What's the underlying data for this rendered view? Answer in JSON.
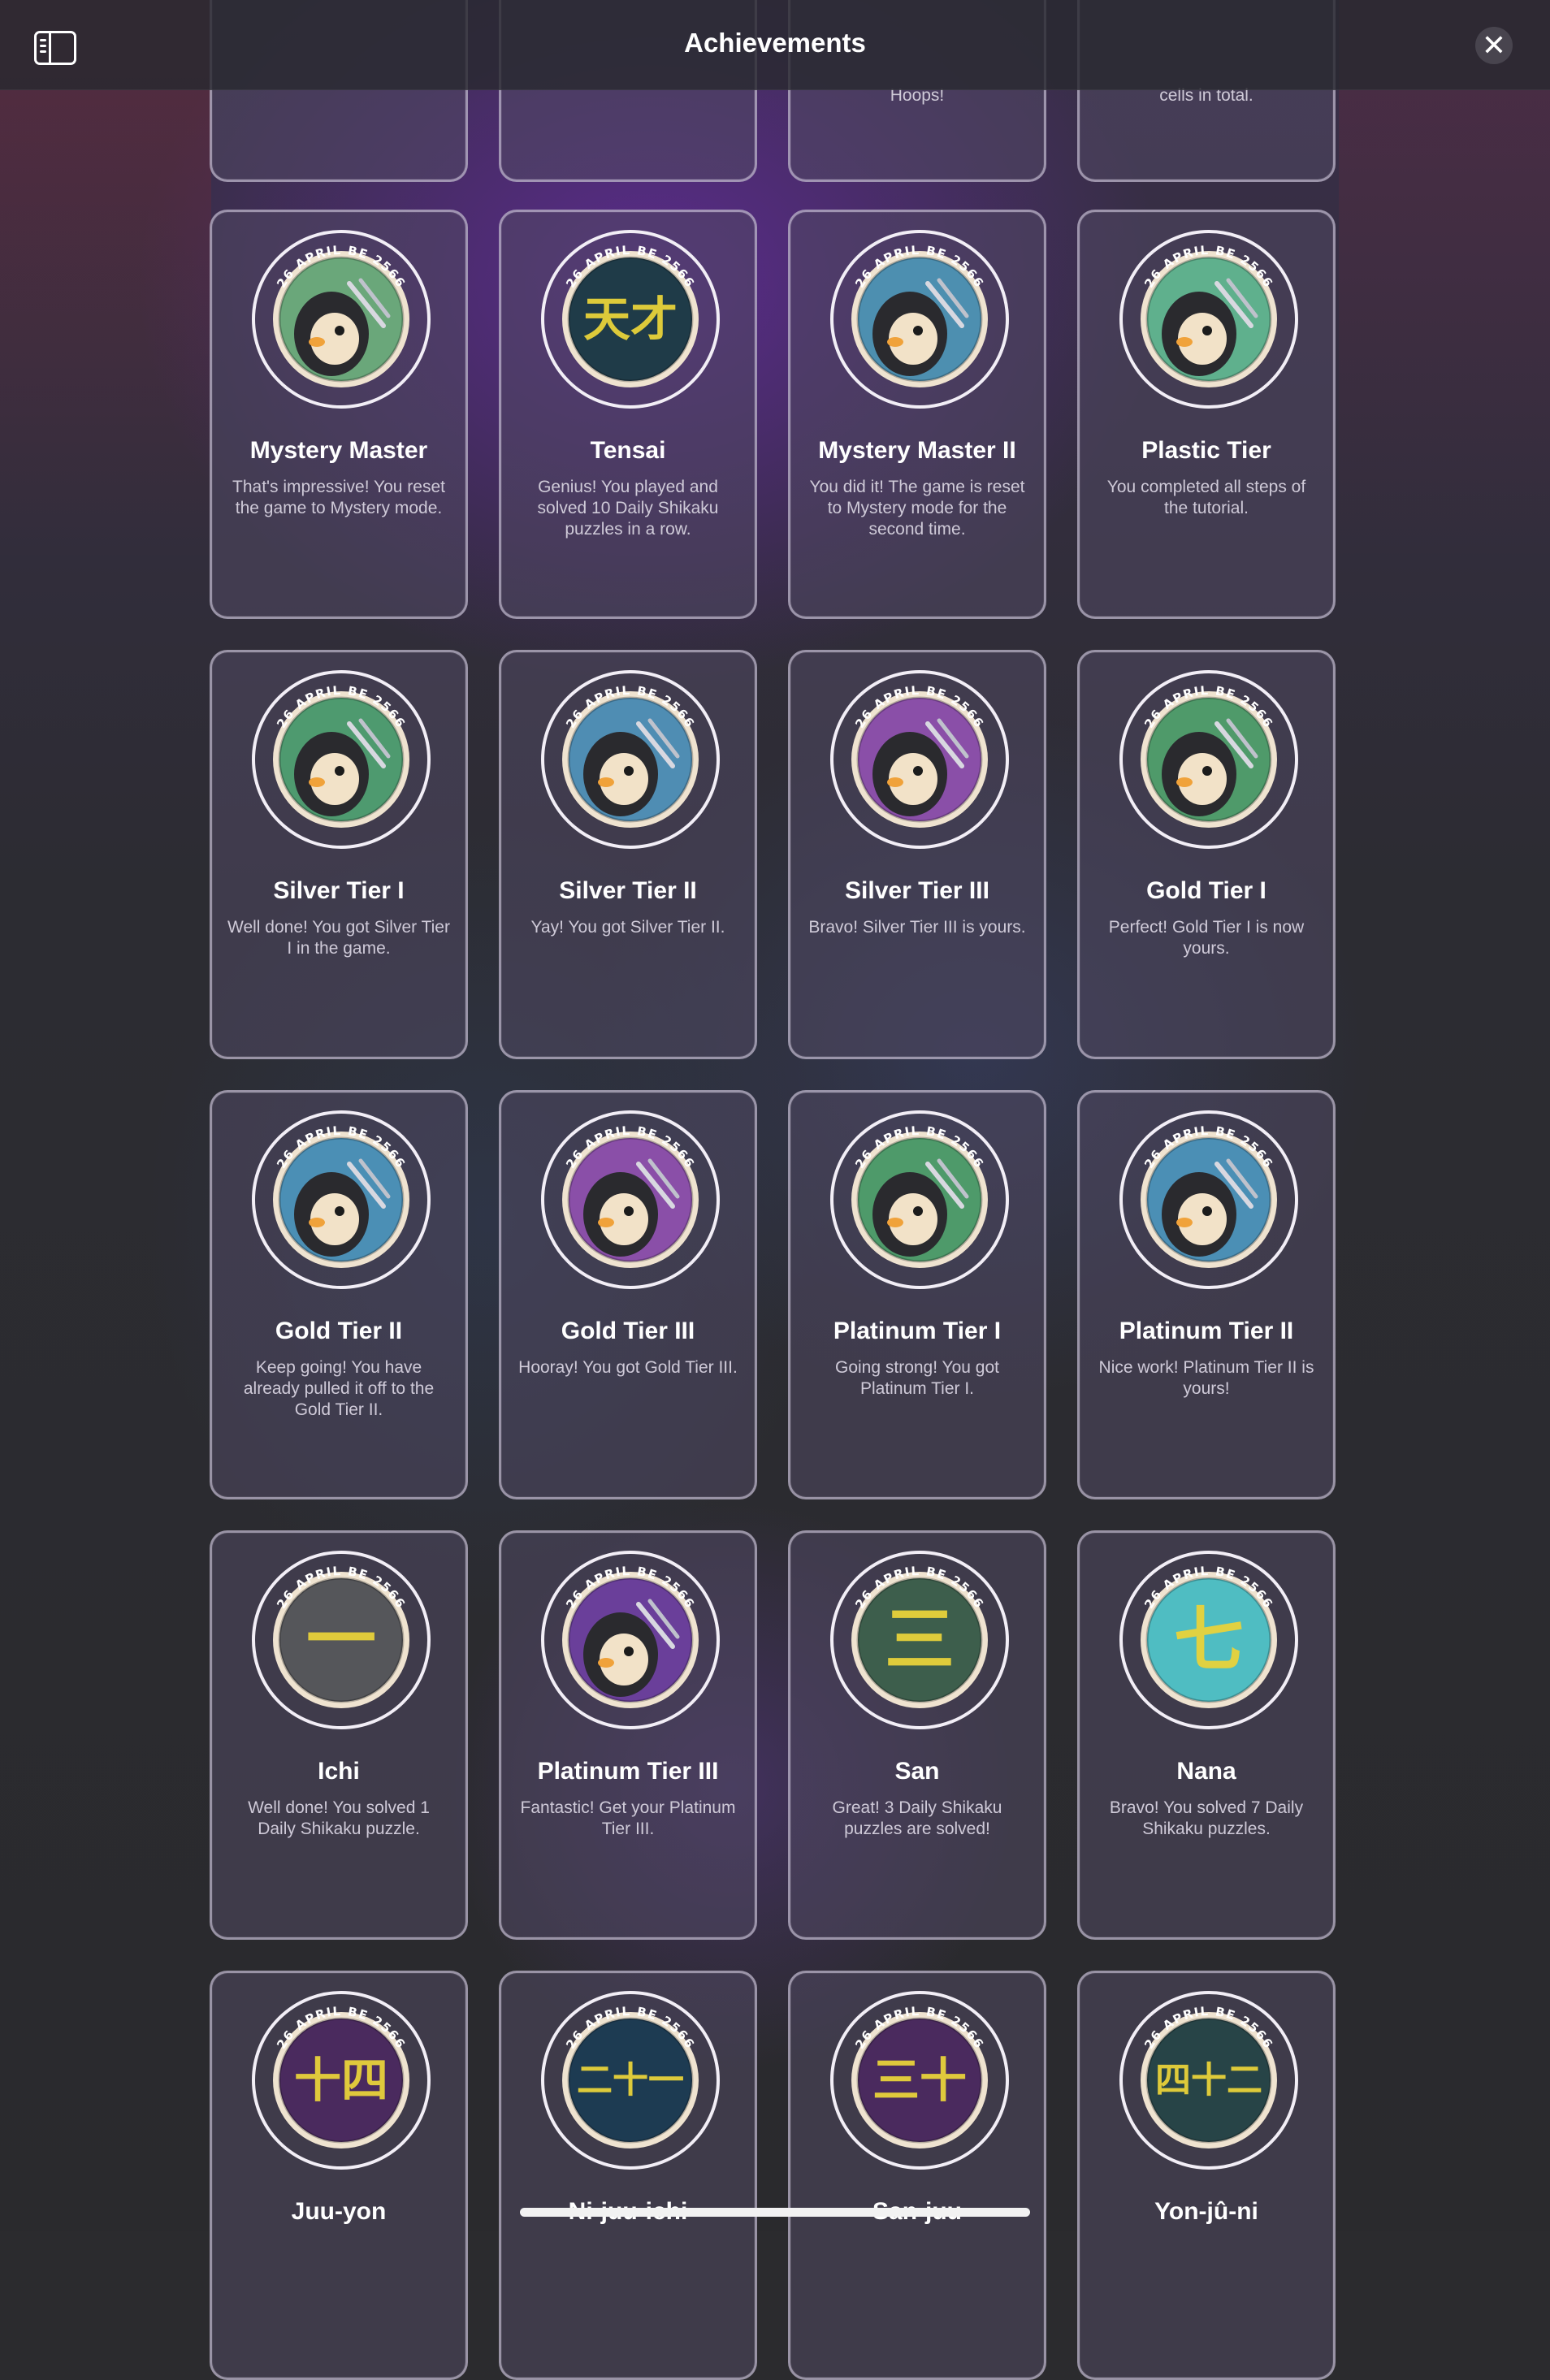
{
  "header": {
    "title": "Achievements"
  },
  "badge_arc_text": "26 APRIL BE 2566",
  "top_partial_row": [
    {
      "desc": ""
    },
    {
      "desc": ""
    },
    {
      "desc": "Hoops!"
    },
    {
      "desc": "cells in total."
    }
  ],
  "cards": [
    {
      "name": "Mystery Master",
      "desc": "That's impressive! You reset the game to Mystery mode.",
      "icon": "detective-penguin-icon",
      "theme": "#6aa77a"
    },
    {
      "name": "Tensai",
      "desc": "Genius! You played and solved 10 Daily Shikaku puzzles in a row.",
      "icon": "tensai-kanji-icon",
      "theme": "#1f3b48",
      "glyph": "天才"
    },
    {
      "name": "Mystery Master II",
      "desc": "You did it! The game is reset to Mystery mode for the second time.",
      "icon": "detective-penguin-icon",
      "theme": "#4d8fb0"
    },
    {
      "name": "Plastic Tier",
      "desc": "You completed all steps of the tutorial.",
      "icon": "plastic-scissors-penguin-icon",
      "theme": "#5fb08d"
    },
    {
      "name": "Silver Tier I",
      "desc": "Well done! You got Silver Tier I in the game.",
      "icon": "silver-scissors-penguin-icon",
      "theme": "#4e9a6f"
    },
    {
      "name": "Silver Tier II",
      "desc": "Yay! You got Silver Tier II.",
      "icon": "silver-scissors-penguin-icon",
      "theme": "#4f8db3"
    },
    {
      "name": "Silver Tier III",
      "desc": "Bravo! Silver Tier III is yours.",
      "icon": "silver-scissors-penguin-icon",
      "theme": "#8a4fa8"
    },
    {
      "name": "Gold Tier I",
      "desc": "Perfect! Gold Tier I is now yours.",
      "icon": "gold-scissors-penguin-icon",
      "theme": "#4f9a6a"
    },
    {
      "name": "Gold Tier II",
      "desc": "Keep going! You have already pulled it off to the Gold Tier II.",
      "icon": "gold-scissors-penguin-icon",
      "theme": "#4b8fb5"
    },
    {
      "name": "Gold Tier III",
      "desc": "Hooray! You got Gold Tier III.",
      "icon": "gold-scissors-penguin-icon",
      "theme": "#8a4fa8"
    },
    {
      "name": "Platinum Tier I",
      "desc": "Going strong! You got Platinum Tier I.",
      "icon": "platinum-scissors-penguin-icon",
      "theme": "#4e9a6a"
    },
    {
      "name": "Platinum Tier II",
      "desc": "Nice work! Platinum Tier II is yours!",
      "icon": "platinum-scissors-penguin-icon",
      "theme": "#4b8fb5"
    },
    {
      "name": "Ichi",
      "desc": "Well done! You solved 1 Daily Shikaku puzzle.",
      "icon": "ichi-kanji-icon",
      "theme": "#55565a",
      "glyph": "一"
    },
    {
      "name": "Platinum Tier III",
      "desc": "Fantastic! Get your Platinum Tier III.",
      "icon": "platinum-scissors-penguin-icon",
      "theme": "#6a3f9a"
    },
    {
      "name": "San",
      "desc": "Great! 3 Daily Shikaku puzzles are solved!",
      "icon": "san-kanji-icon",
      "theme": "#3d5e4c",
      "glyph": "三"
    },
    {
      "name": "Nana",
      "desc": "Bravo! You solved 7 Daily Shikaku puzzles.",
      "icon": "nana-kanji-icon",
      "theme": "#4fbdc2",
      "glyph": "七"
    },
    {
      "name": "Juu-yon",
      "desc": "",
      "icon": "juuyon-kanji-icon",
      "theme": "#4a2a5e",
      "glyph": "十四"
    },
    {
      "name": "Ni-juu-ichi",
      "desc": "",
      "icon": "nijuuichi-kanji-icon",
      "theme": "#1d3b52",
      "glyph": "二十一"
    },
    {
      "name": "San-juu",
      "desc": "",
      "icon": "sanjuu-kanji-icon",
      "theme": "#4a2a5e",
      "glyph": "三十"
    },
    {
      "name": "Yon-jû-ni",
      "desc": "",
      "icon": "yonjuuni-kanji-icon",
      "theme": "#274447",
      "glyph": "四十二"
    }
  ]
}
